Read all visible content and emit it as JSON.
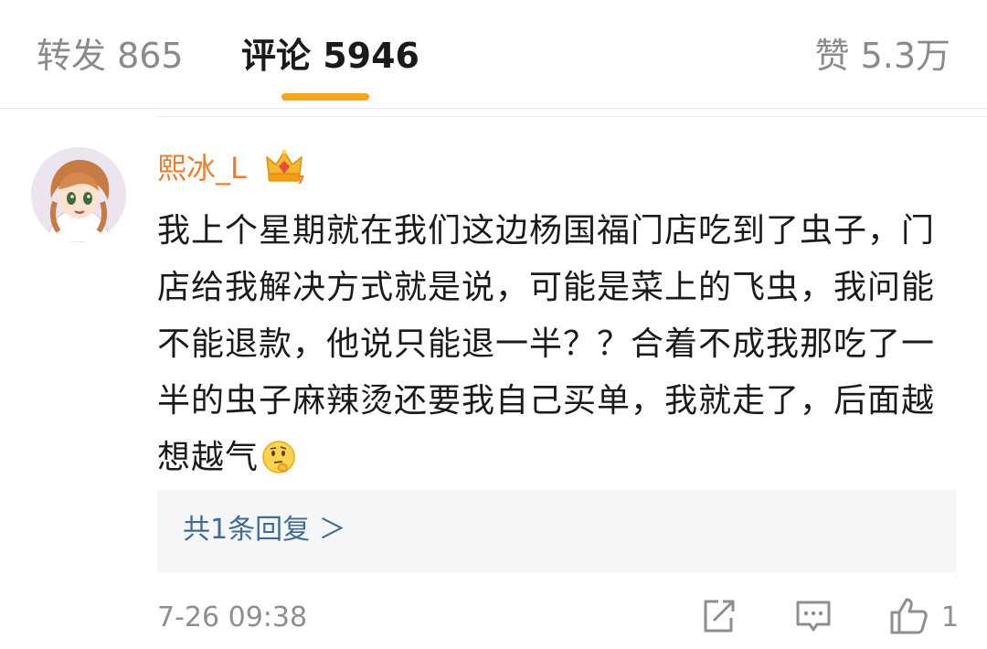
{
  "tabs": {
    "repost": "转发 865",
    "comments": "评论 5946",
    "likes": "赞 5.3万"
  },
  "comment": {
    "username": "熙冰_L",
    "user_badge": "crown-icon",
    "text": "我上个星期就在我们这边杨国福门店吃到了虫子，门店给我解决方式就是说，可能是菜上的飞虫，我问能不能退款，他说只能退一半？？合着不成我那吃了一半的虫子麻辣烫还要我自己买单，我就走了，后面越想越气",
    "emoji": "thinking-emoji",
    "reply_link": "共1条回复 ＞",
    "timestamp": "7-26 09:38",
    "like_count": "1"
  },
  "colors": {
    "accent": "#f6a41b",
    "username": "#ed7d2f",
    "link": "#416a95"
  }
}
